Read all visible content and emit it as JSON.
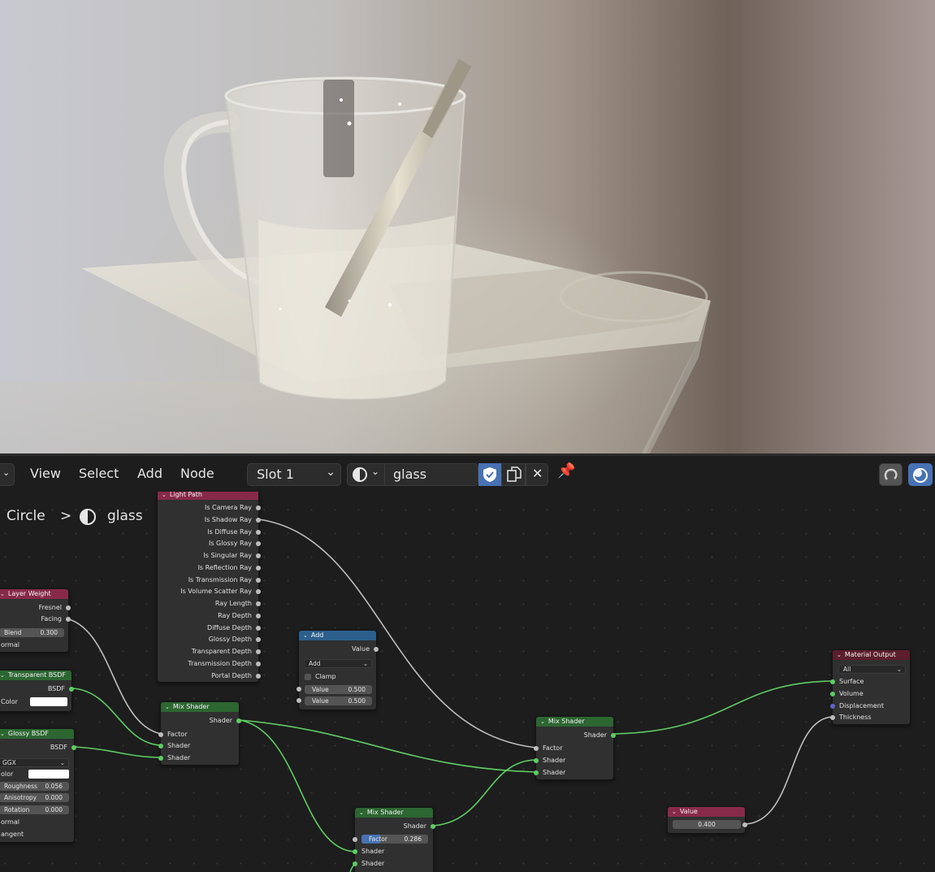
{
  "viewport": {
    "scene": "Rendered glass mug with a straw on a white surface"
  },
  "header": {
    "menus": [
      "View",
      "Select",
      "Add",
      "Node"
    ],
    "slot": "Slot 1",
    "material_name": "glass"
  },
  "breadcrumb": {
    "object": "Circle",
    "separator": ">",
    "material": "glass"
  },
  "nodes": {
    "light_path": {
      "title": "Light Path",
      "outputs": [
        "Is Camera Ray",
        "Is Shadow Ray",
        "Is Diffuse Ray",
        "Is Glossy Ray",
        "Is Singular Ray",
        "Is Reflection Ray",
        "Is Transmission Ray",
        "Is Volume Scatter Ray",
        "Ray Length",
        "Ray Depth",
        "Diffuse Depth",
        "Glossy Depth",
        "Transparent Depth",
        "Transmission Depth",
        "Portal Depth"
      ]
    },
    "layer_weight": {
      "title": "Layer Weight",
      "out_fresnel": "Fresnel",
      "out_facing": "Facing",
      "blend_label": "Blend",
      "blend_value": "0.300",
      "normal_label": "ormal"
    },
    "transparent_bsdf": {
      "title": "Transparent BSDF",
      "out_bsdf": "BSDF",
      "color_label": "Color",
      "color": "#ffffff"
    },
    "glossy_bsdf": {
      "title": "Glossy BSDF",
      "out_bsdf": "BSDF",
      "distribution": "GGX",
      "color_label": "olor",
      "color": "#ffffff",
      "roughness_label": "Roughness",
      "roughness_value": "0.056",
      "anisotropy_label": "Anisotropy",
      "anisotropy_value": "0.000",
      "rotation_label": "Rotation",
      "rotation_value": "0.000",
      "normal_label": "ormal",
      "tangent_label": "angent"
    },
    "add": {
      "title": "Add",
      "out_value": "Value",
      "operation": "Add",
      "clamp_label": "Clamp",
      "value1_label": "Value",
      "value1": "0.500",
      "value2_label": "Value",
      "value2": "0.500"
    },
    "mix1": {
      "title": "Mix Shader",
      "out_shader": "Shader",
      "in_factor": "Factor",
      "in_shader1": "Shader",
      "in_shader2": "Shader"
    },
    "mix2": {
      "title": "Mix Shader",
      "out_shader": "Shader",
      "in_factor": "Factor",
      "in_shader1": "Shader",
      "in_shader2": "Shader"
    },
    "mix3": {
      "title": "Mix Shader",
      "out_shader": "Shader",
      "factor_label": "Factor",
      "factor_value": "0.286",
      "factor_fill": 0.286,
      "in_shader1": "Shader",
      "in_shader2": "Shader"
    },
    "material_output": {
      "title": "Material Output",
      "target": "All",
      "in_surface": "Surface",
      "in_volume": "Volume",
      "in_displacement": "Displacement",
      "in_thickness": "Thickness"
    },
    "value": {
      "title": "Value",
      "value": "0.400"
    }
  },
  "colors": {
    "socket_shader": "#5ecc63",
    "socket_float": "#bdbdbd",
    "socket_vector": "#6363c7",
    "header_input": "#872a4a",
    "header_shader": "#2c6631",
    "header_converter": "#2c5f8c",
    "header_output": "#5c1e2c",
    "accent": "#4772b3"
  }
}
